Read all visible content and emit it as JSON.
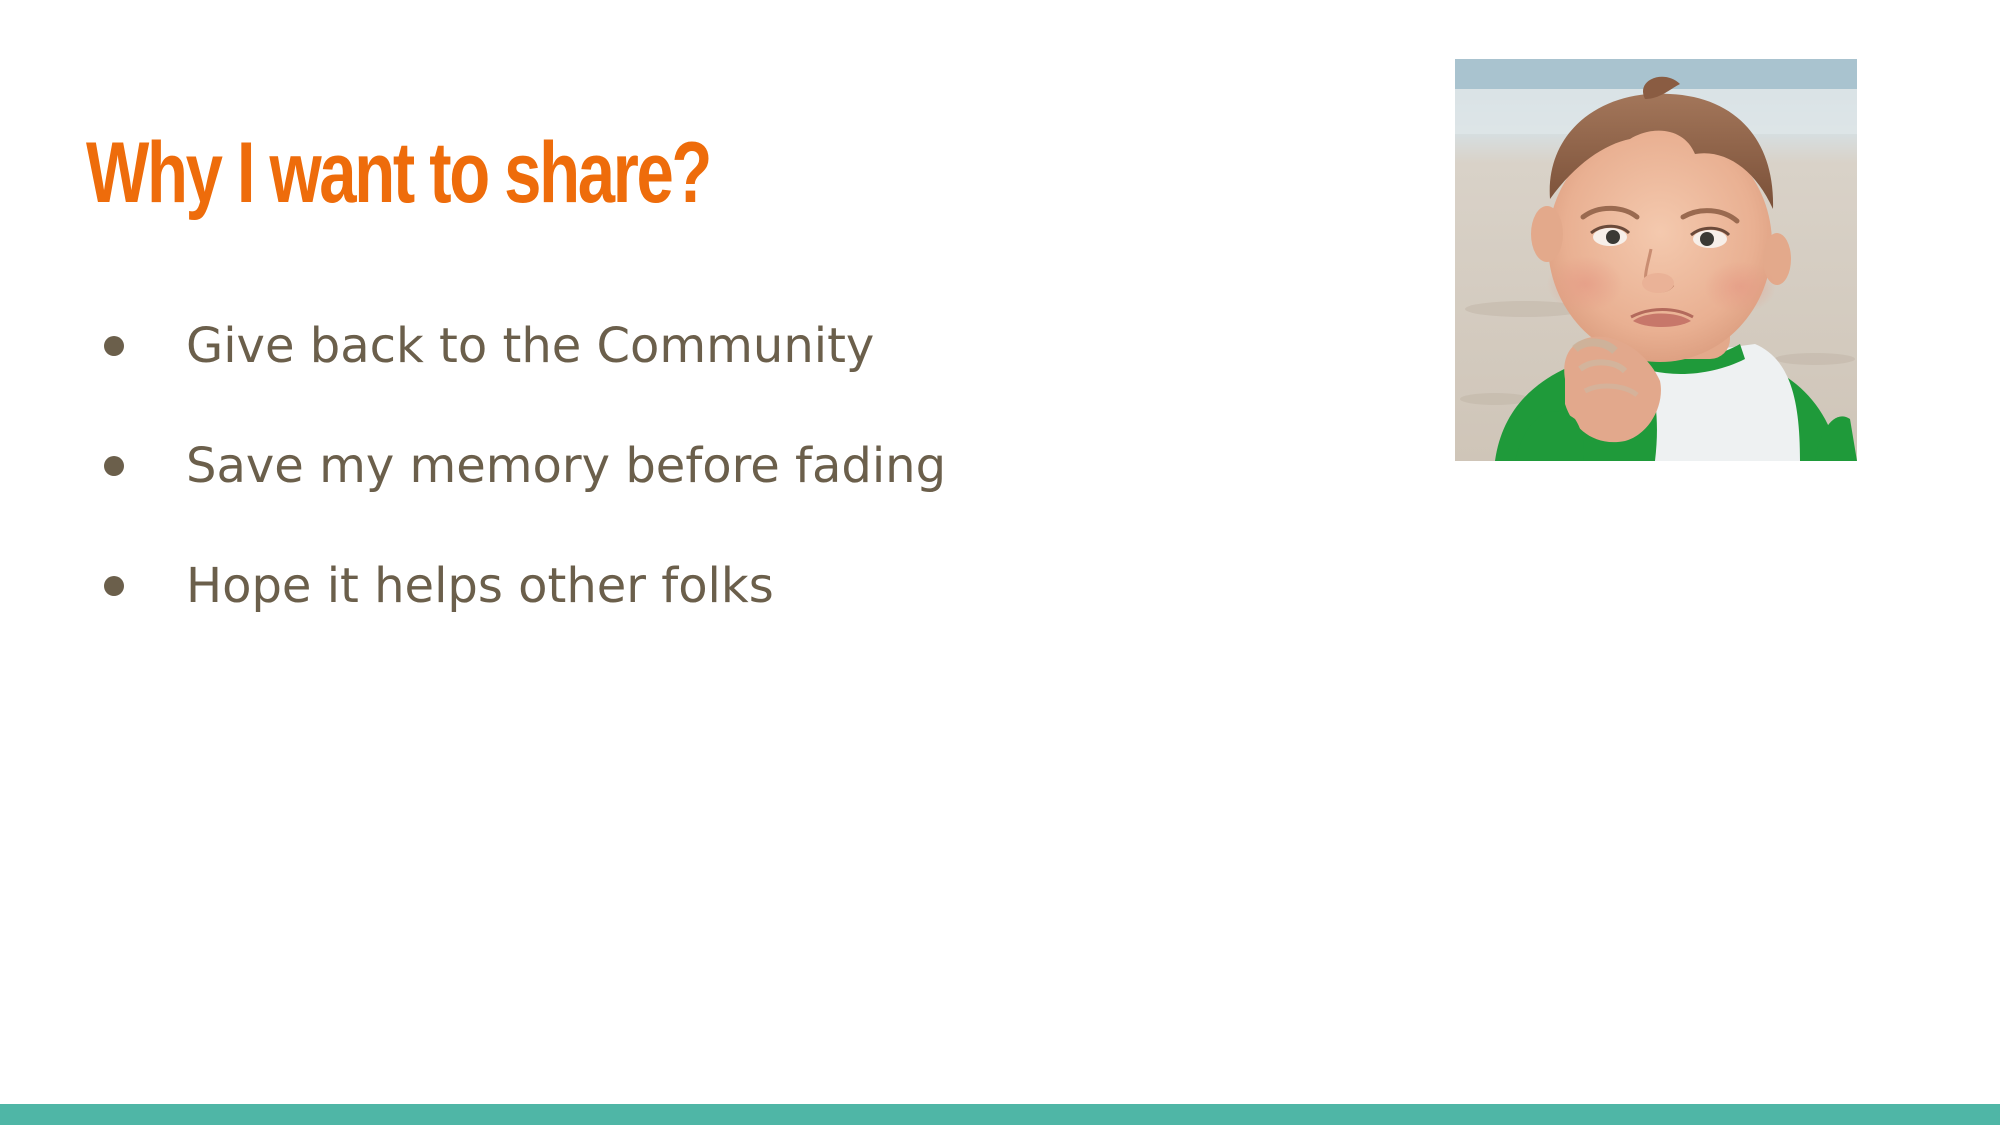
{
  "slide": {
    "title": "Why I want to share?",
    "bullets": [
      {
        "text": "Give back to the Community"
      },
      {
        "text": "Save my memory before fading"
      },
      {
        "text": "Hope it helps other folks"
      }
    ],
    "photo_icon": "success-kid-photo"
  },
  "colors": {
    "title": "#ee6c0b",
    "body_text": "#6b5f4b",
    "bullet": "#6b5f4b",
    "footer_bar": "#4fb6a6",
    "background": "#ffffff"
  }
}
